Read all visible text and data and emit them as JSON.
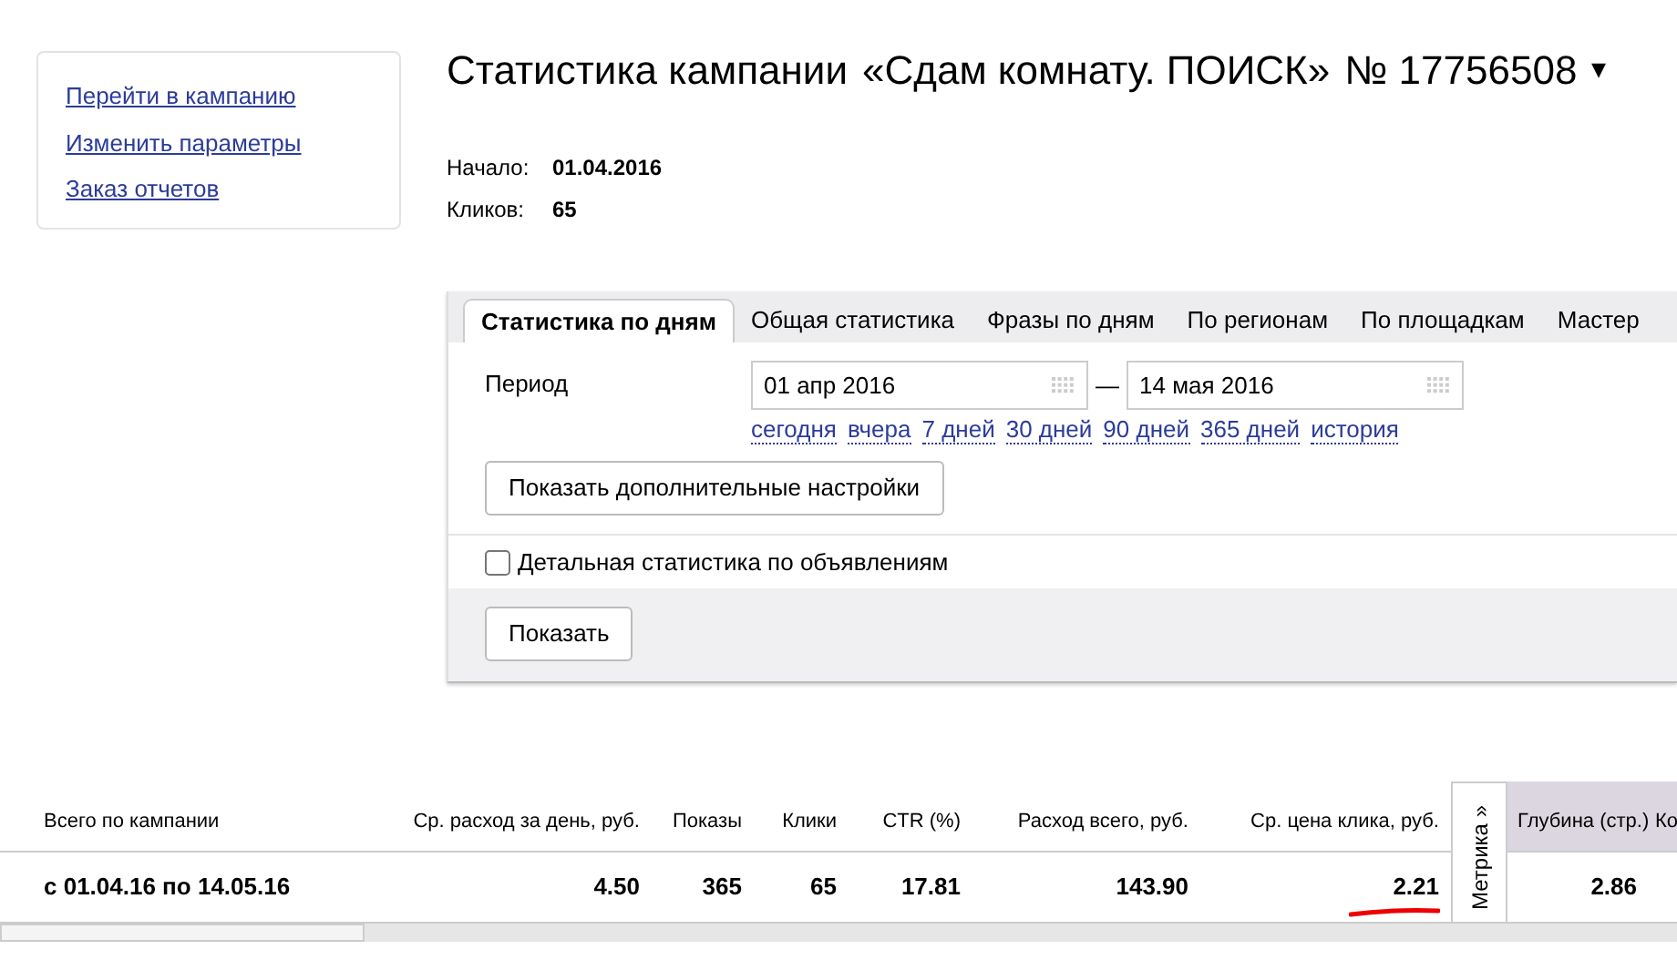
{
  "sidebar": {
    "links": [
      "Перейти в кампанию",
      "Изменить параметры",
      "Заказ отчетов"
    ]
  },
  "title": {
    "text": "Статистика кампании",
    "campaign": "«Сдам комнату. ПОИСК»",
    "number": "№ 17756508",
    "caret": "▾"
  },
  "info": [
    {
      "label": "Начало:",
      "value": "01.04.2016"
    },
    {
      "label": "Кликов:",
      "value": "65"
    }
  ],
  "tabs": [
    {
      "label": "Статистика по дням",
      "selected": true
    },
    {
      "label": "Общая статистика",
      "selected": false
    },
    {
      "label": "Фразы по дням",
      "selected": false
    },
    {
      "label": "По регионам",
      "selected": false
    },
    {
      "label": "По площадкам",
      "selected": false
    },
    {
      "label": "Мастер",
      "selected": false
    }
  ],
  "period": {
    "label": "Период",
    "date_from": "01 апр 2016",
    "separator": "—",
    "date_to": "14 мая 2016",
    "quick_links": [
      "сегодня",
      "вчера",
      "7 дней",
      "30 дней",
      "90 дней",
      "365 дней",
      "история"
    ]
  },
  "more_settings_button": "Показать дополнительные настройки",
  "detail_checkbox": {
    "label": "Детальная статистика по объявлениям",
    "checked": false
  },
  "show_button": "Показать",
  "table": {
    "columns": [
      "Всего по кампании",
      "Ср. расход за день, руб.",
      "Показы",
      "Клики",
      "CTR (%)",
      "Расход всего, руб.",
      "Ср. цена клика, руб.",
      "Глубина (стр.)",
      "Ко"
    ],
    "metrika_tab": "Метрика »",
    "rows": [
      {
        "cells": [
          "с 01.04.16 по 14.05.16",
          "4.50",
          "365",
          "65",
          "17.81",
          "143.90",
          "2.21",
          "2.86",
          ""
        ]
      }
    ]
  }
}
